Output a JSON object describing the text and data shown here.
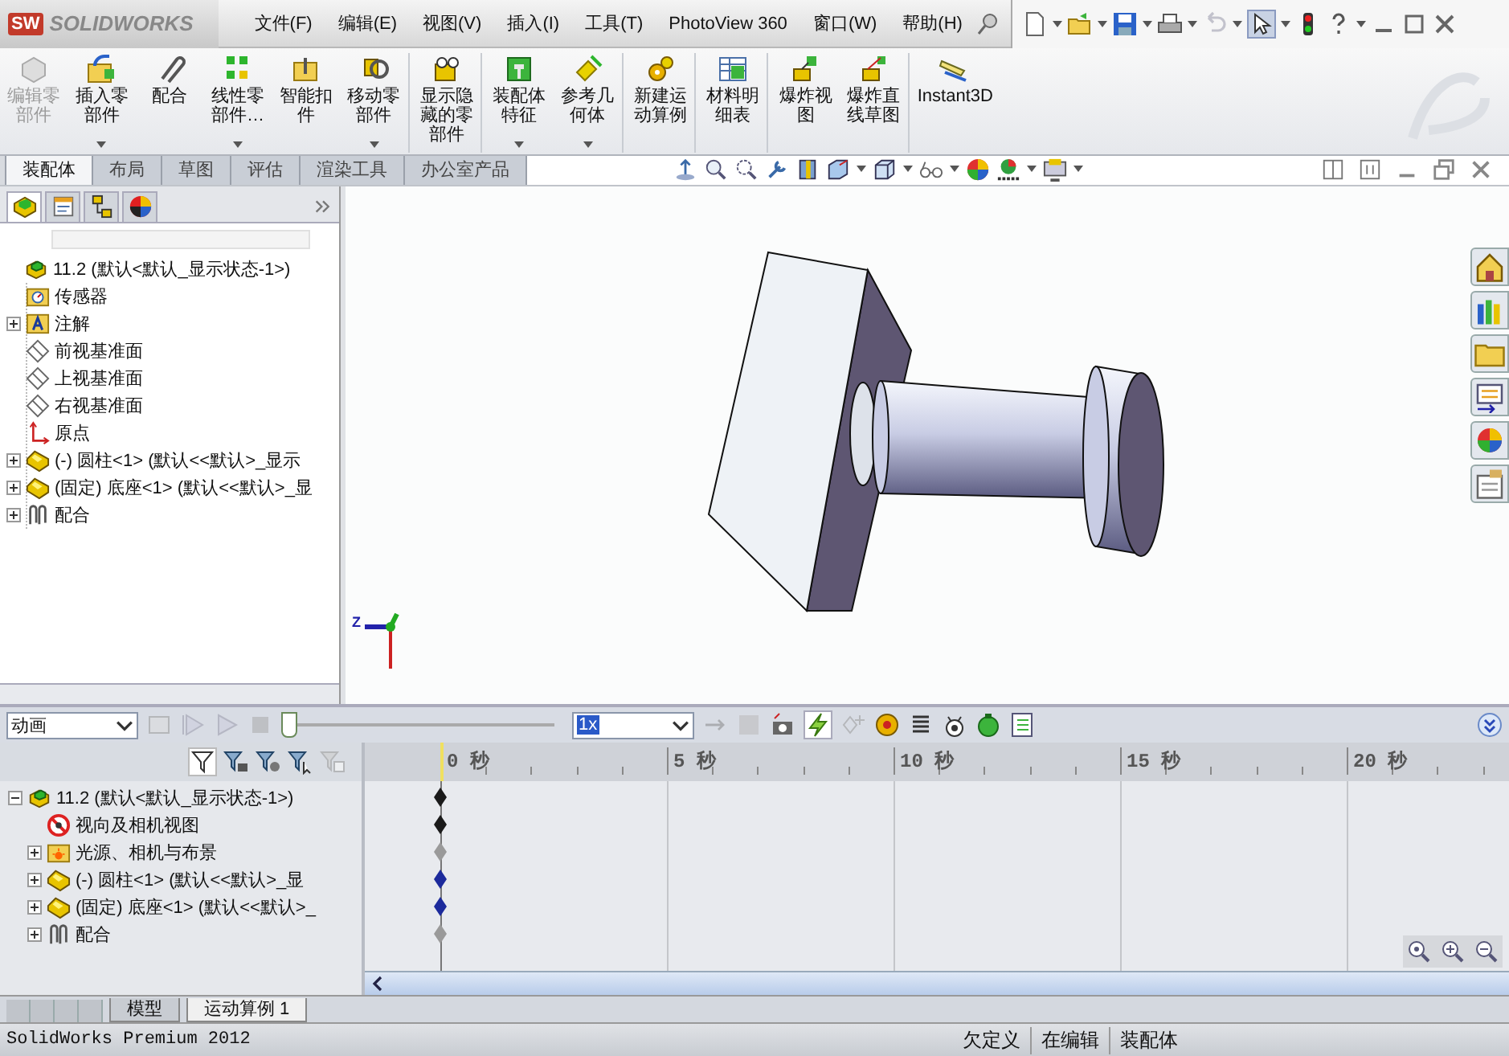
{
  "title_bar": {
    "logo_mark": "SW",
    "logo_text": "SOLIDWORKS",
    "menus": [
      "文件(F)",
      "编辑(E)",
      "视图(V)",
      "插入(I)",
      "工具(T)",
      "PhotoView 360",
      "窗口(W)",
      "帮助(H)"
    ]
  },
  "ribbon": {
    "buttons": [
      {
        "kind": "edit-component",
        "label": "编辑零部件",
        "disabled": true,
        "has_menu": false,
        "separator_after": false
      },
      {
        "kind": "insert",
        "label": "插入零部件",
        "disabled": false,
        "has_menu": true,
        "separator_after": false
      },
      {
        "kind": "mate",
        "label": "配合",
        "disabled": false,
        "has_menu": false,
        "separator_after": false
      },
      {
        "kind": "linear",
        "label": "线性零部件…",
        "disabled": false,
        "has_menu": true,
        "separator_after": false
      },
      {
        "kind": "fastener",
        "label": "智能扣件",
        "disabled": false,
        "has_menu": false,
        "separator_after": false
      },
      {
        "kind": "move",
        "label": "移动零部件",
        "disabled": false,
        "has_menu": true,
        "separator_after": true
      },
      {
        "kind": "show-hidden",
        "label": "显示隐藏的零部件",
        "disabled": false,
        "has_menu": false,
        "separator_after": true
      },
      {
        "kind": "feature",
        "label": "装配体特征",
        "disabled": false,
        "has_menu": true,
        "separator_after": false
      },
      {
        "kind": "ref-geometry",
        "label": "参考几何体",
        "disabled": false,
        "has_menu": true,
        "separator_after": true
      },
      {
        "kind": "motion-study",
        "label": "新建运动算例",
        "disabled": false,
        "has_menu": false,
        "separator_after": true
      },
      {
        "kind": "bom",
        "label": "材料明细表",
        "disabled": false,
        "has_menu": false,
        "separator_after": true
      },
      {
        "kind": "explode",
        "label": "爆炸视图",
        "disabled": false,
        "has_menu": false,
        "separator_after": false
      },
      {
        "kind": "explode-sketch",
        "label": "爆炸直线草图",
        "disabled": false,
        "has_menu": false,
        "separator_after": true
      },
      {
        "kind": "instant3d",
        "label": "Instant3D",
        "disabled": false,
        "has_menu": false,
        "separator_after": false
      }
    ],
    "tabs": [
      {
        "label": "装配体",
        "selected": true
      },
      {
        "label": "布局",
        "selected": false
      },
      {
        "label": "草图",
        "selected": false
      },
      {
        "label": "评估",
        "selected": false
      },
      {
        "label": "渲染工具",
        "selected": false
      },
      {
        "label": "办公室产品",
        "selected": false
      }
    ]
  },
  "feature_manager": {
    "tabs": [
      {
        "kind": "feature-tree",
        "selected": true
      },
      {
        "kind": "property",
        "selected": false
      },
      {
        "kind": "configuration",
        "selected": false
      },
      {
        "kind": "display",
        "selected": false
      }
    ],
    "tree": {
      "kind": "assembly",
      "label": "11.2  (默认<默认_显示状态-1>)",
      "children": [
        {
          "kind": "sensor",
          "label": "传感器"
        },
        {
          "kind": "annotation",
          "label": "注解",
          "expanded": false
        },
        {
          "kind": "plane",
          "label": "前视基准面"
        },
        {
          "kind": "plane",
          "label": "上视基准面"
        },
        {
          "kind": "plane",
          "label": "右视基准面"
        },
        {
          "kind": "origin",
          "label": "原点"
        },
        {
          "kind": "part",
          "label": "(-) 圆柱<1> (默认<<默认>_显示",
          "expanded": false
        },
        {
          "kind": "part",
          "label": "(固定) 底座<1> (默认<<默认>_显",
          "expanded": false
        },
        {
          "kind": "mates",
          "label": "配合",
          "expanded": false
        }
      ]
    }
  },
  "viewport": {
    "triad_label": "Z"
  },
  "motion_manager": {
    "study_type": "动画",
    "playback_slider": {
      "level": 0
    },
    "speed": "1x",
    "tree": {
      "kind": "assembly",
      "label": "11.2  (默认<默认_显示状态-1>)",
      "expanded": true,
      "color": "#1a1a1a",
      "children": [
        {
          "kind": "camera",
          "label": "视向及相机视图",
          "color": "#1a1a1a"
        },
        {
          "kind": "lights",
          "label": "光源、相机与布景",
          "expanded": false,
          "color": "#9a9a9a"
        },
        {
          "kind": "part",
          "label": "(-) 圆柱<1> (默认<<默认>_显",
          "expanded": false,
          "color": "#1c2a9c"
        },
        {
          "kind": "part",
          "label": "(固定) 底座<1> (默认<<默认>_",
          "expanded": false,
          "color": "#1c2a9c"
        },
        {
          "kind": "mates",
          "label": "配合",
          "expanded": false,
          "color": "#9a9a9a"
        }
      ]
    },
    "ruler": [
      "0 秒",
      "5 秒",
      "10 秒",
      "15 秒",
      "20 秒"
    ]
  },
  "bottom_tabs": [
    {
      "label": "模型",
      "selected": false
    },
    {
      "label": "运动算例 1",
      "selected": true
    }
  ],
  "status_bar": {
    "product": "SolidWorks Premium 2012",
    "state": "欠定义",
    "mode": "在编辑",
    "document": "装配体"
  }
}
